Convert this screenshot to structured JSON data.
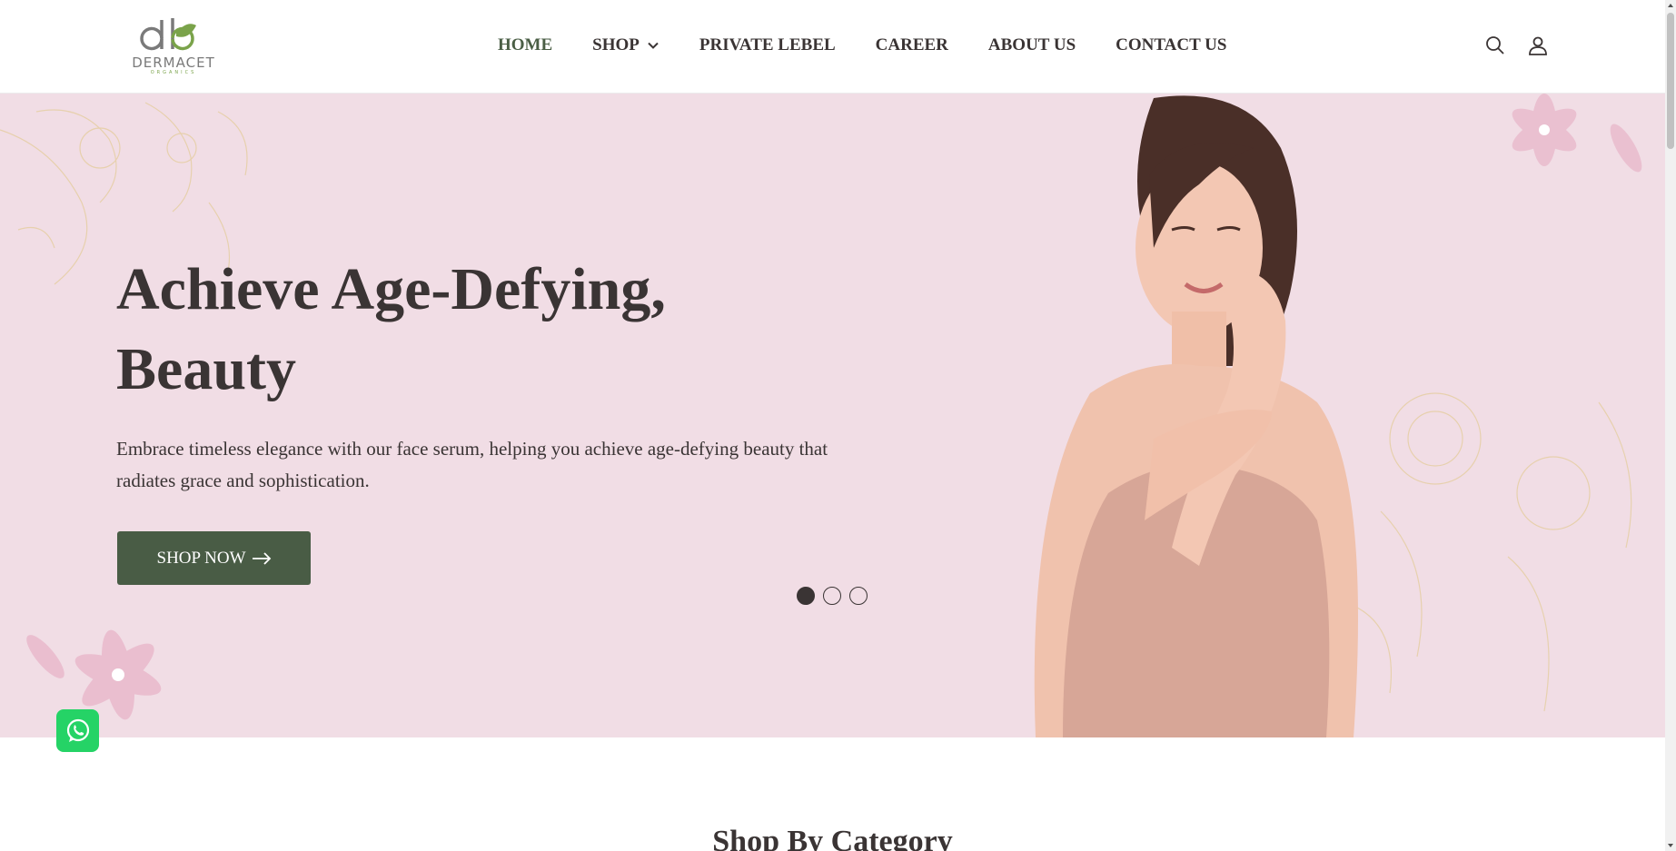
{
  "brand": {
    "name": "DERMACET",
    "sub": "ORGANICS"
  },
  "nav": {
    "home": "HOME",
    "shop": "SHOP",
    "private_label": "PRIVATE LEBEL",
    "career": "CAREER",
    "about": "ABOUT US",
    "contact": "CONTACT US"
  },
  "header_icons": [
    "search-icon",
    "user-icon"
  ],
  "hero": {
    "title_line1": "Achieve Age-Defying,",
    "title_line2": "Beauty",
    "description": "Embrace timeless elegance with our face serum, helping you achieve age-defying beauty that radiates grace and sophistication.",
    "button_label": "SHOP NOW",
    "slides_total": 3,
    "slide_active": 1
  },
  "section": {
    "title": "Shop By Category"
  },
  "colors": {
    "primary_green": "#495c45",
    "hero_bg": "#f1dde5",
    "text_dark": "#3a3434",
    "whatsapp": "#25d366"
  }
}
